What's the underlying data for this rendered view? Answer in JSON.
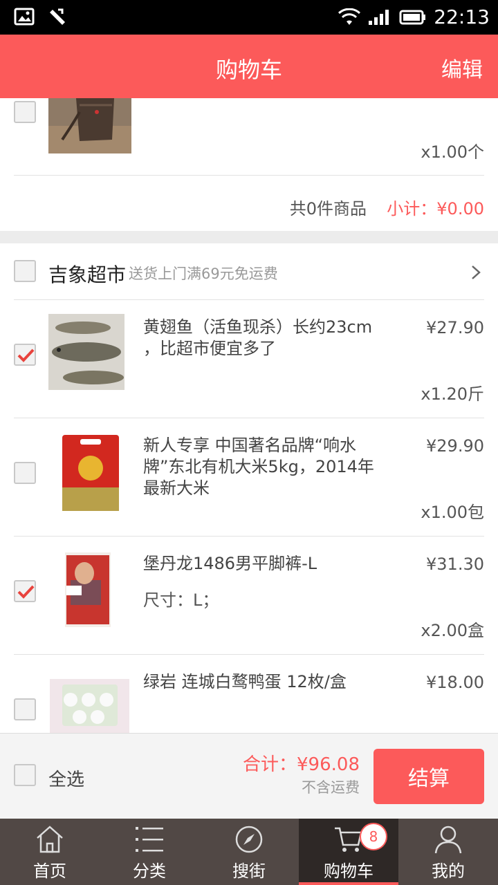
{
  "status_bar": {
    "time": "22:13"
  },
  "header": {
    "title": "购物车",
    "edit": "编辑"
  },
  "group1": {
    "item_qty": "x1.00个",
    "summary_count": "共0件商品",
    "summary_subtotal": "小计：¥0.00"
  },
  "store": {
    "name": "吉象超市",
    "note": "送货上门满69元免运费",
    "items": [
      {
        "title": "黄翅鱼（活鱼现杀）长约23cm ，比超市便宜多了",
        "price": "¥27.90",
        "qty": "x1.20斤",
        "checked": true
      },
      {
        "title": "新人专享 中国著名品牌“响水牌”东北有机大米5kg，2014年最新大米",
        "price": "¥29.90",
        "qty": "x1.00包",
        "checked": false
      },
      {
        "title": "堡丹龙1486男平脚裤-L",
        "spec": "尺寸：L；",
        "price": "¥31.30",
        "qty": "x2.00盒",
        "checked": true
      },
      {
        "title": "绿岩 连城白鹜鸭蛋 12枚/盒",
        "price": "¥18.00",
        "checked": false
      }
    ]
  },
  "checkout": {
    "select_all": "全选",
    "total": "合计：¥96.08",
    "shipping_note": "不含运费",
    "button": "结算"
  },
  "tabs": [
    {
      "label": "首页",
      "icon": "home-icon"
    },
    {
      "label": "分类",
      "icon": "list-icon"
    },
    {
      "label": "搜街",
      "icon": "compass-icon"
    },
    {
      "label": "购物车",
      "icon": "cart-icon",
      "badge": "8",
      "active": true
    },
    {
      "label": "我的",
      "icon": "user-icon"
    }
  ],
  "colors": {
    "accent": "#fc5a5a",
    "tabbar": "#514845",
    "tab_active": "#2e2826"
  }
}
